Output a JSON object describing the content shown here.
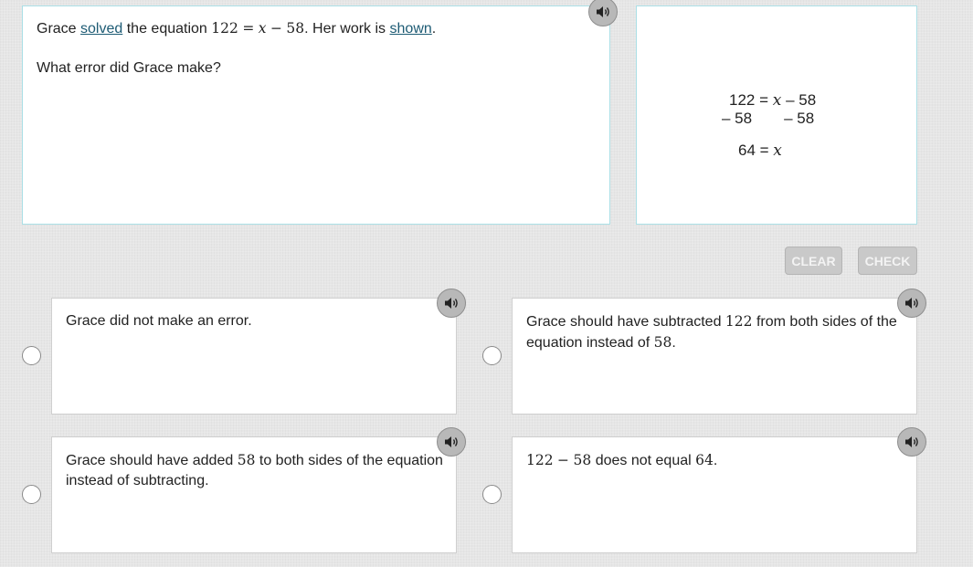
{
  "stem": {
    "intro": "Grace",
    "solved_link": "solved",
    "text_mid": "the equation",
    "eq_a": "122",
    "eq_eq": "=",
    "eq_x": "x",
    "eq_minus": "−",
    "eq_b": "58",
    "text_after": ". Her work is",
    "shown_link": "shown",
    "text_end": ".",
    "question": "What error did Grace make?"
  },
  "work": {
    "line1_left": "122 =",
    "line1_var": "x",
    "line1_right": "– 58",
    "line2_left": "– 58",
    "line2_right": "– 58",
    "line3_left": "64 =",
    "line3_var": "x"
  },
  "buttons": {
    "clear": "CLEAR",
    "check": "CHECK"
  },
  "options": [
    {
      "text": "Grace did not make an error."
    },
    {
      "pre": "Grace should have subtracted",
      "num": "122",
      "post": "from both sides of the equation instead of",
      "num2": "58",
      "end": "."
    },
    {
      "pre": "Grace should have added",
      "num": "58",
      "post": "to both sides of the equation instead of subtracting."
    },
    {
      "a": "122",
      "op": "−",
      "b": "58",
      "post": "does not equal",
      "c": "64",
      "end": "."
    }
  ],
  "icons": {
    "speaker": "speaker-icon",
    "radio": "radio-button-icon"
  },
  "colors": {
    "card_border": "#aadfe6",
    "link": "#1d5b74",
    "button_bg": "#c9c9c9",
    "button_text": "#f3f3f3"
  }
}
